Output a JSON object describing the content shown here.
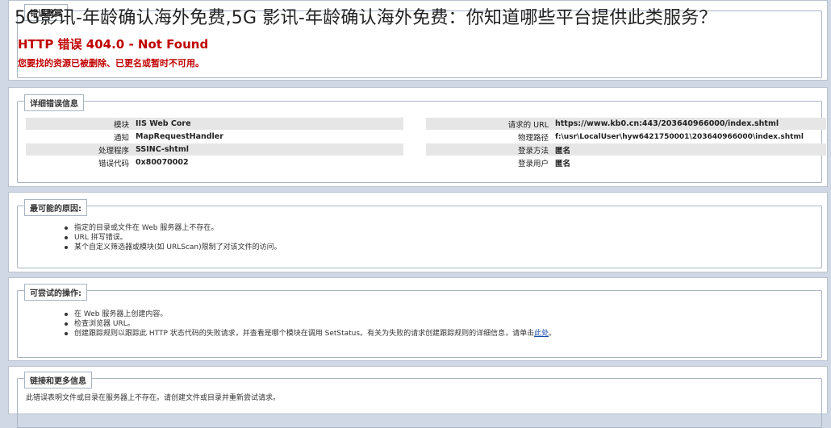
{
  "overlay_title": "5G影讯-年龄确认海外免费,5G 影讯-年龄确认海外免费：你知道哪些平台提供此类服务？",
  "header_panel": {
    "legend": "错误摘要",
    "error_title": "HTTP 错误 404.0 - Not Found",
    "error_message": "您要找的资源已被删除、已更名或暂时不可用。"
  },
  "details": {
    "legend": "详细错误信息",
    "left": [
      {
        "label": "模块",
        "value": "IIS Web Core"
      },
      {
        "label": "通知",
        "value": "MapRequestHandler"
      },
      {
        "label": "处理程序",
        "value": "SSINC-shtml"
      },
      {
        "label": "错误代码",
        "value": "0x80070002"
      }
    ],
    "right": [
      {
        "label": "请求的 URL",
        "value": "https://www.kb0.cn:443/203640966000/index.shtml"
      },
      {
        "label": "物理路径",
        "value": "f:\\usr\\LocalUser\\hyw6421750001\\203640966000\\index.shtml"
      },
      {
        "label": "登录方法",
        "value": "匿名"
      },
      {
        "label": "登录用户",
        "value": "匿名"
      }
    ]
  },
  "causes": {
    "legend": "最可能的原因:",
    "items": [
      "指定的目录或文件在 Web 服务器上不存在。",
      "URL 拼写错误。",
      "某个自定义筛选器或模块(如 URLScan)限制了对该文件的访问。"
    ]
  },
  "actions": {
    "legend": "可尝试的操作:",
    "items": [
      "在 Web 服务器上创建内容。",
      "检查浏览器 URL。",
      "创建跟踪规则以跟踪此 HTTP 状态代码的失败请求，并查看是哪个模块在调用 SetStatus。有关为失败的请求创建跟踪规则的详细信息，请单击"
    ],
    "link_text": "此处",
    "link_suffix": "。"
  },
  "links": {
    "legend": "链接和更多信息",
    "text": "此错误表明文件或目录在服务器上不存在。请创建文件或目录并重新尝试请求。"
  }
}
